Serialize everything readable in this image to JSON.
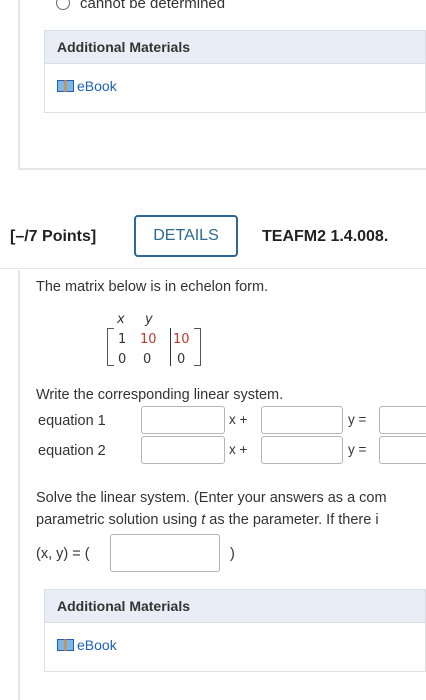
{
  "top": {
    "radio_text": "cannot be determined"
  },
  "additional_materials_1": {
    "header": "Additional Materials",
    "ebook_label": "eBook"
  },
  "question": {
    "points": "[–/7 Points]",
    "details_button": "DETAILS",
    "problem_id": "TEAFM2 1.4.008.",
    "prompt": "The matrix below is in echelon form.",
    "matrix": {
      "col_labels": [
        "x",
        "y"
      ],
      "rows": [
        [
          "1",
          "10",
          "10"
        ],
        [
          "0",
          "0",
          "0"
        ]
      ]
    },
    "write_prompt": "Write the corresponding linear system.",
    "equation1_label": "equation 1",
    "equation2_label": "equation 2",
    "x_plus": "x +",
    "y_equals": "y =",
    "solve_line1": "Solve the linear system. (Enter your answers as a com",
    "solve_line2_a": "parametric solution using ",
    "solve_line2_t": "t",
    "solve_line2_b": " as the parameter. If there i",
    "answer_label": "(x, y) = (",
    "answer_close": ")"
  },
  "additional_materials_2": {
    "header": "Additional Materials",
    "ebook_label": "eBook"
  },
  "colors": {
    "link": "#1e5fb8",
    "details_border": "#2c6a92",
    "matrix_red": "#c0392b",
    "panel_header_bg": "#e9edf5"
  },
  "icons": [
    "radio-button-icon",
    "ebook-icon"
  ]
}
